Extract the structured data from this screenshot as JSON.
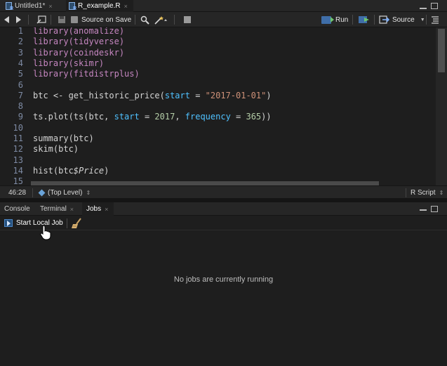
{
  "editor_tabs": [
    {
      "label": "Untitled1*",
      "close": "×"
    },
    {
      "label": "R_example.R",
      "close": "×"
    }
  ],
  "toolbar": {
    "source_on_save": "Source on Save",
    "run": "Run",
    "source": "Source"
  },
  "code_lines": [
    {
      "n": "1",
      "parts": [
        {
          "t": "library",
          "c": "kw"
        },
        {
          "t": "(anomalize)",
          "c": "kw"
        }
      ]
    },
    {
      "n": "2",
      "parts": [
        {
          "t": "library",
          "c": "kw"
        },
        {
          "t": "(tidyverse)",
          "c": "kw"
        }
      ]
    },
    {
      "n": "3",
      "parts": [
        {
          "t": "library",
          "c": "kw"
        },
        {
          "t": "(coindeskr)",
          "c": "kw"
        }
      ]
    },
    {
      "n": "4",
      "parts": [
        {
          "t": "library",
          "c": "kw"
        },
        {
          "t": "(skimr)",
          "c": "kw"
        }
      ]
    },
    {
      "n": "5",
      "parts": [
        {
          "t": "library",
          "c": "kw"
        },
        {
          "t": "(fitdistrplus)",
          "c": "kw"
        }
      ]
    },
    {
      "n": "6",
      "parts": []
    },
    {
      "n": "7",
      "parts": [
        {
          "t": "btc <- get_historic_price(",
          "c": "fn"
        },
        {
          "t": "start",
          "c": "arg"
        },
        {
          "t": " = ",
          "c": "fn"
        },
        {
          "t": "\"2017-01-01\"",
          "c": "str"
        },
        {
          "t": ")",
          "c": "fn"
        }
      ]
    },
    {
      "n": "8",
      "parts": []
    },
    {
      "n": "9",
      "parts": [
        {
          "t": "ts.plot(ts(btc, ",
          "c": "fn"
        },
        {
          "t": "start",
          "c": "arg"
        },
        {
          "t": " = ",
          "c": "fn"
        },
        {
          "t": "2017",
          "c": "num"
        },
        {
          "t": ", ",
          "c": "fn"
        },
        {
          "t": "frequency",
          "c": "arg"
        },
        {
          "t": " = ",
          "c": "fn"
        },
        {
          "t": "365",
          "c": "num"
        },
        {
          "t": "))",
          "c": "fn"
        }
      ]
    },
    {
      "n": "10",
      "parts": []
    },
    {
      "n": "11",
      "parts": [
        {
          "t": "summary(btc)",
          "c": "fn"
        }
      ]
    },
    {
      "n": "12",
      "parts": [
        {
          "t": "skim(btc)",
          "c": "fn"
        }
      ]
    },
    {
      "n": "13",
      "parts": []
    },
    {
      "n": "14",
      "parts": [
        {
          "t": "hist(btc",
          "c": "fn"
        },
        {
          "t": "$Price",
          "c": "ital"
        },
        {
          "t": ")",
          "c": "fn"
        }
      ]
    },
    {
      "n": "15",
      "parts": []
    }
  ],
  "status": {
    "position": "46:28",
    "scope": "(Top Level)",
    "file_type": "R Script"
  },
  "panel_tabs": [
    {
      "label": "Console",
      "close": ""
    },
    {
      "label": "Terminal",
      "close": "×"
    },
    {
      "label": "Jobs",
      "close": "×"
    }
  ],
  "jobs": {
    "start_local_job": "Start Local Job",
    "empty_message": "No jobs are currently running"
  },
  "colors": {
    "keyword": "#c586c0",
    "string": "#ce9178",
    "number": "#b5cea8",
    "argument": "#4fc1ff",
    "line_number": "#7d8aa3"
  }
}
